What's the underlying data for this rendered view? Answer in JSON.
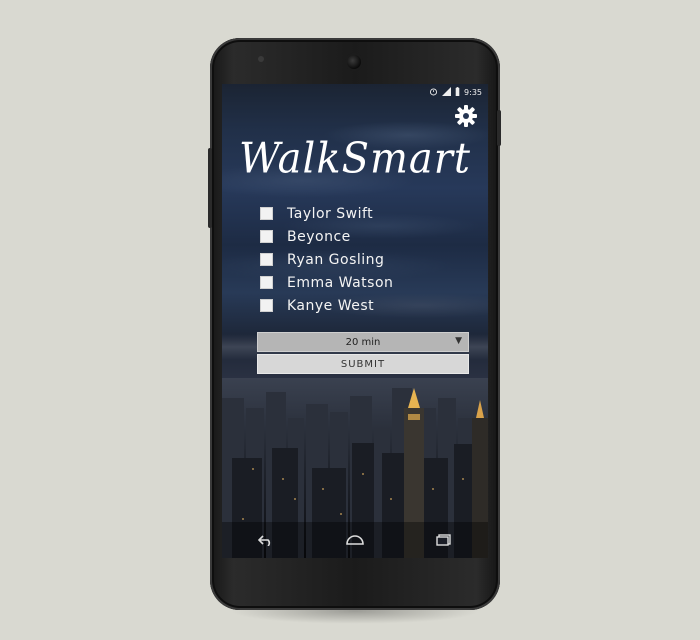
{
  "status": {
    "time": "9:35",
    "icons": [
      "alarm-icon",
      "signal-icon",
      "battery-icon"
    ]
  },
  "app": {
    "title": "WalkSmart"
  },
  "celebrities": [
    {
      "label": "Taylor Swift",
      "checked": false
    },
    {
      "label": "Beyonce",
      "checked": false
    },
    {
      "label": "Ryan Gosling",
      "checked": false
    },
    {
      "label": "Emma Watson",
      "checked": false
    },
    {
      "label": "Kanye West",
      "checked": false
    }
  ],
  "duration": {
    "selected": "20 min"
  },
  "actions": {
    "submit_label": "SUBMIT"
  },
  "nav": {
    "icons": [
      "back-icon",
      "home-icon",
      "recents-icon"
    ]
  },
  "colors": {
    "sky": "#213049",
    "text": "#ffffff",
    "select_bg": "#b5b5b5",
    "submit_bg": "#d7d7d7"
  }
}
